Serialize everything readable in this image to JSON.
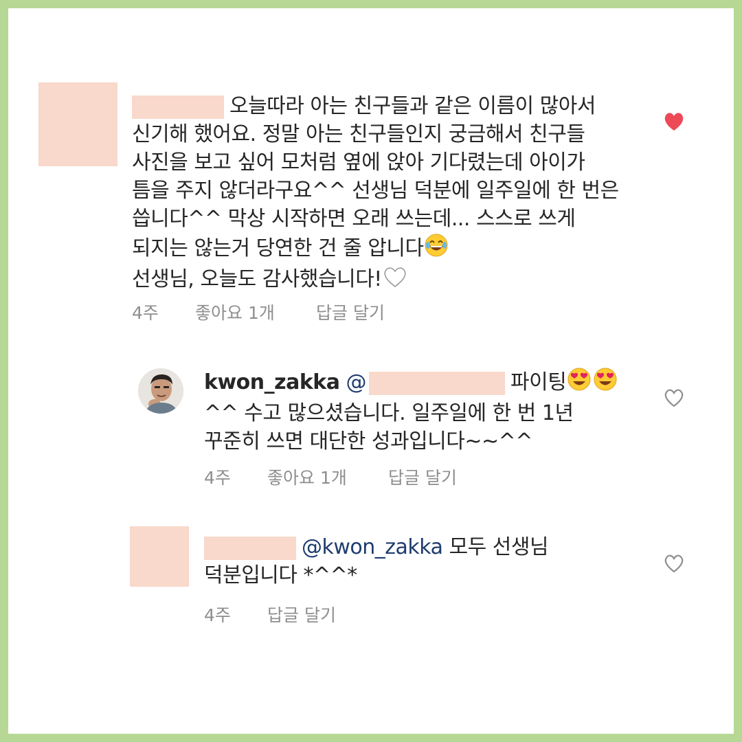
{
  "comments": [
    {
      "lines": [
        "오늘따라 아는 친구들과 같은 이름이 많아서",
        "신기해 했어요. 정말 아는 친구들인지 궁금해서 친구들",
        "사진을 보고 싶어 모처럼 옆에 앉아 기다렸는데 아이가",
        "틈을 주지 않더라구요^^ 선생님 덕분에 일주일에 한 번은",
        "씁니다^^ 막상 시작하면 오래 쓰는데... 스스로 쓰게",
        "되지는 않는거 당연한 건 줄 압니다",
        "선생님, 오늘도 감사했습니다!"
      ],
      "time": "4주",
      "likes": "좋아요 1개",
      "reply": "답글 달기",
      "liked": true
    },
    {
      "username": "kwon_zakka",
      "at": "@",
      "line1_tail": "파이팅",
      "line2": "^^ 수고 많으셨습니다. 일주일에 한 번 1년",
      "line3": "꾸준히 쓰면 대단한 성과입니다~~^^",
      "time": "4주",
      "likes": "좋아요 1개",
      "reply": "답글 달기",
      "liked": false
    },
    {
      "mention": "@kwon_zakka",
      "line1_tail": "모두 선생님",
      "line2": "덕분입니다 *^^*",
      "time": "4주",
      "reply": "답글 달기",
      "liked": false
    }
  ],
  "colors": {
    "border": "#b6d894",
    "blur": "#f8d9cb",
    "heart_active": "#ed4956",
    "meta": "#8e8e8e",
    "mention": "#1e3c6e"
  }
}
